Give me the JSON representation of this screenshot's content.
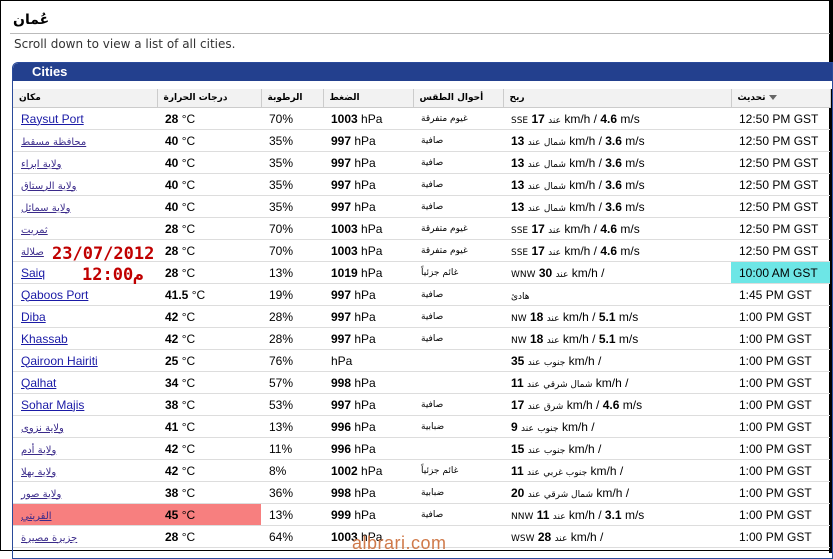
{
  "page": {
    "title": "عُمان",
    "subtitle": "Scroll down to view a list of all cities."
  },
  "panel": {
    "title": "Cities"
  },
  "columns": {
    "city": "مكان",
    "temp": "درجات الحرارة",
    "humidity": "الرطوبة",
    "pressure": "الضغط",
    "conditions": "أحوال الطقس",
    "wind": "ريح",
    "updated": "تحديث"
  },
  "rows": [
    {
      "city": "Raysut Port",
      "ar": false,
      "temp": "28",
      "temp_unit": "°C",
      "humidity": "70%",
      "pressure": "1003",
      "pressure_unit": "hPa",
      "cond": "غيوم متفرقة",
      "wind_dir": "SSE",
      "wind_sep": "عند",
      "wind_speed": "17",
      "wind_kmh": "km/h /",
      "wind_ms": "4.6",
      "wind_ms_unit": "m/s",
      "updated": "12:50 PM GST"
    },
    {
      "city": "محافظة مسقط",
      "ar": true,
      "temp": "40",
      "temp_unit": "°C",
      "humidity": "35%",
      "pressure": "997",
      "pressure_unit": "hPa",
      "cond": "صافية",
      "wind_dir": "شمال",
      "wind_sep": "عند",
      "wind_speed": "13",
      "wind_kmh": "km/h /",
      "wind_ms": "3.6",
      "wind_ms_unit": "m/s",
      "updated": "12:50 PM GST"
    },
    {
      "city": "ولاية ابراء",
      "ar": true,
      "temp": "40",
      "temp_unit": "°C",
      "humidity": "35%",
      "pressure": "997",
      "pressure_unit": "hPa",
      "cond": "صافية",
      "wind_dir": "شمال",
      "wind_sep": "عند",
      "wind_speed": "13",
      "wind_kmh": "km/h /",
      "wind_ms": "3.6",
      "wind_ms_unit": "m/s",
      "updated": "12:50 PM GST"
    },
    {
      "city": "ولاية الرستاق",
      "ar": true,
      "temp": "40",
      "temp_unit": "°C",
      "humidity": "35%",
      "pressure": "997",
      "pressure_unit": "hPa",
      "cond": "صافية",
      "wind_dir": "شمال",
      "wind_sep": "عند",
      "wind_speed": "13",
      "wind_kmh": "km/h /",
      "wind_ms": "3.6",
      "wind_ms_unit": "m/s",
      "updated": "12:50 PM GST"
    },
    {
      "city": "ولاية سمائل",
      "ar": true,
      "temp": "40",
      "temp_unit": "°C",
      "humidity": "35%",
      "pressure": "997",
      "pressure_unit": "hPa",
      "cond": "صافية",
      "wind_dir": "شمال",
      "wind_sep": "عند",
      "wind_speed": "13",
      "wind_kmh": "km/h /",
      "wind_ms": "3.6",
      "wind_ms_unit": "m/s",
      "updated": "12:50 PM GST"
    },
    {
      "city": "ثمريت",
      "ar": true,
      "temp": "28",
      "temp_unit": "°C",
      "humidity": "70%",
      "pressure": "1003",
      "pressure_unit": "hPa",
      "cond": "غيوم متفرقة",
      "wind_dir": "SSE",
      "wind_sep": "عند",
      "wind_speed": "17",
      "wind_kmh": "km/h /",
      "wind_ms": "4.6",
      "wind_ms_unit": "m/s",
      "updated": "12:50 PM GST"
    },
    {
      "city": "صلالة",
      "ar": true,
      "temp": "28",
      "temp_unit": "°C",
      "humidity": "70%",
      "pressure": "1003",
      "pressure_unit": "hPa",
      "cond": "غيوم متفرقة",
      "wind_dir": "SSE",
      "wind_sep": "عند",
      "wind_speed": "17",
      "wind_kmh": "km/h /",
      "wind_ms": "4.6",
      "wind_ms_unit": "m/s",
      "updated": "12:50 PM GST"
    },
    {
      "city": "Saiq",
      "ar": false,
      "temp": "28",
      "temp_unit": "°C",
      "humidity": "13%",
      "pressure": "1019",
      "pressure_unit": "hPa",
      "cond": "غائم جزئياً",
      "wind_dir": "WNW",
      "wind_sep": "عند",
      "wind_speed": "30",
      "wind_kmh": "km/h /",
      "wind_ms": "",
      "wind_ms_unit": "",
      "updated": "10:00 AM GST",
      "highlight": "time"
    },
    {
      "city": "Qaboos Port",
      "ar": false,
      "temp": "41.5",
      "temp_unit": "°C",
      "humidity": "19%",
      "pressure": "997",
      "pressure_unit": "hPa",
      "cond": "صافية",
      "wind_dir": "هادئ",
      "wind_sep": "",
      "wind_speed": "",
      "wind_kmh": "",
      "wind_ms": "",
      "wind_ms_unit": "",
      "updated": "1:45 PM GST"
    },
    {
      "city": "Diba",
      "ar": false,
      "temp": "42",
      "temp_unit": "°C",
      "humidity": "28%",
      "pressure": "997",
      "pressure_unit": "hPa",
      "cond": "صافية",
      "wind_dir": "NW",
      "wind_sep": "عند",
      "wind_speed": "18",
      "wind_kmh": "km/h /",
      "wind_ms": "5.1",
      "wind_ms_unit": "m/s",
      "updated": "1:00 PM GST"
    },
    {
      "city": "Khassab",
      "ar": false,
      "temp": "42",
      "temp_unit": "°C",
      "humidity": "28%",
      "pressure": "997",
      "pressure_unit": "hPa",
      "cond": "صافية",
      "wind_dir": "NW",
      "wind_sep": "عند",
      "wind_speed": "18",
      "wind_kmh": "km/h /",
      "wind_ms": "5.1",
      "wind_ms_unit": "m/s",
      "updated": "1:00 PM GST"
    },
    {
      "city": "Qairoon Hairiti",
      "ar": false,
      "temp": "25",
      "temp_unit": "°C",
      "humidity": "76%",
      "pressure": "",
      "pressure_unit": "hPa",
      "cond": "",
      "wind_dir": "جنوب",
      "wind_sep": "عند",
      "wind_speed": "35",
      "wind_kmh": "km/h /",
      "wind_ms": "",
      "wind_ms_unit": "",
      "updated": "1:00 PM GST"
    },
    {
      "city": "Qalhat",
      "ar": false,
      "temp": "34",
      "temp_unit": "°C",
      "humidity": "57%",
      "pressure": "998",
      "pressure_unit": "hPa",
      "cond": "",
      "wind_dir": "شمال شرقي",
      "wind_sep": "عند",
      "wind_speed": "11",
      "wind_kmh": "km/h /",
      "wind_ms": "",
      "wind_ms_unit": "",
      "updated": "1:00 PM GST"
    },
    {
      "city": "Sohar Majis",
      "ar": false,
      "temp": "38",
      "temp_unit": "°C",
      "humidity": "53%",
      "pressure": "997",
      "pressure_unit": "hPa",
      "cond": "صافية",
      "wind_dir": "شرق",
      "wind_sep": "عند",
      "wind_speed": "17",
      "wind_kmh": "km/h /",
      "wind_ms": "4.6",
      "wind_ms_unit": "m/s",
      "updated": "1:00 PM GST"
    },
    {
      "city": "ولاية نزوى",
      "ar": true,
      "temp": "41",
      "temp_unit": "°C",
      "humidity": "13%",
      "pressure": "996",
      "pressure_unit": "hPa",
      "cond": "ضبابية",
      "wind_dir": "جنوب",
      "wind_sep": "عند",
      "wind_speed": "9",
      "wind_kmh": "km/h /",
      "wind_ms": "",
      "wind_ms_unit": "",
      "updated": "1:00 PM GST"
    },
    {
      "city": "ولاية أدم",
      "ar": true,
      "temp": "42",
      "temp_unit": "°C",
      "humidity": "11%",
      "pressure": "996",
      "pressure_unit": "hPa",
      "cond": "",
      "wind_dir": "جنوب",
      "wind_sep": "عند",
      "wind_speed": "15",
      "wind_kmh": "km/h /",
      "wind_ms": "",
      "wind_ms_unit": "",
      "updated": "1:00 PM GST"
    },
    {
      "city": "ولاية بهلا",
      "ar": true,
      "temp": "42",
      "temp_unit": "°C",
      "humidity": "8%",
      "pressure": "1002",
      "pressure_unit": "hPa",
      "cond": "غائم جزئياً",
      "wind_dir": "جنوب غربي",
      "wind_sep": "عند",
      "wind_speed": "11",
      "wind_kmh": "km/h /",
      "wind_ms": "",
      "wind_ms_unit": "",
      "updated": "1:00 PM GST"
    },
    {
      "city": "ولاية صور",
      "ar": true,
      "temp": "38",
      "temp_unit": "°C",
      "humidity": "36%",
      "pressure": "998",
      "pressure_unit": "hPa",
      "cond": "ضبابية",
      "wind_dir": "شمال شرقي",
      "wind_sep": "عند",
      "wind_speed": "20",
      "wind_kmh": "km/h /",
      "wind_ms": "",
      "wind_ms_unit": "",
      "updated": "1:00 PM GST"
    },
    {
      "city": "القريتي",
      "ar": true,
      "temp": "45",
      "temp_unit": "°C",
      "humidity": "13%",
      "pressure": "999",
      "pressure_unit": "hPa",
      "cond": "صافية",
      "wind_dir": "NNW",
      "wind_sep": "عند",
      "wind_speed": "11",
      "wind_kmh": "km/h /",
      "wind_ms": "3.1",
      "wind_ms_unit": "m/s",
      "updated": "1:00 PM GST",
      "highlight": "row"
    },
    {
      "city": "جزيرة مصيرة",
      "ar": true,
      "temp": "28",
      "temp_unit": "°C",
      "humidity": "64%",
      "pressure": "1003",
      "pressure_unit": "hPa",
      "cond": "",
      "wind_dir": "WSW",
      "wind_sep": "عند",
      "wind_speed": "28",
      "wind_kmh": "km/h /",
      "wind_ms": "",
      "wind_ms_unit": "",
      "updated": "1:00 PM GST"
    }
  ],
  "overlay": {
    "date": "23/07/2012",
    "time": "12:00م",
    "watermark": "albrari.com"
  },
  "colors": {
    "panel_header": "#23408e",
    "highlight_time": "#6de6e6",
    "highlight_row": "#f77f7f",
    "stamp": "#c00000"
  }
}
